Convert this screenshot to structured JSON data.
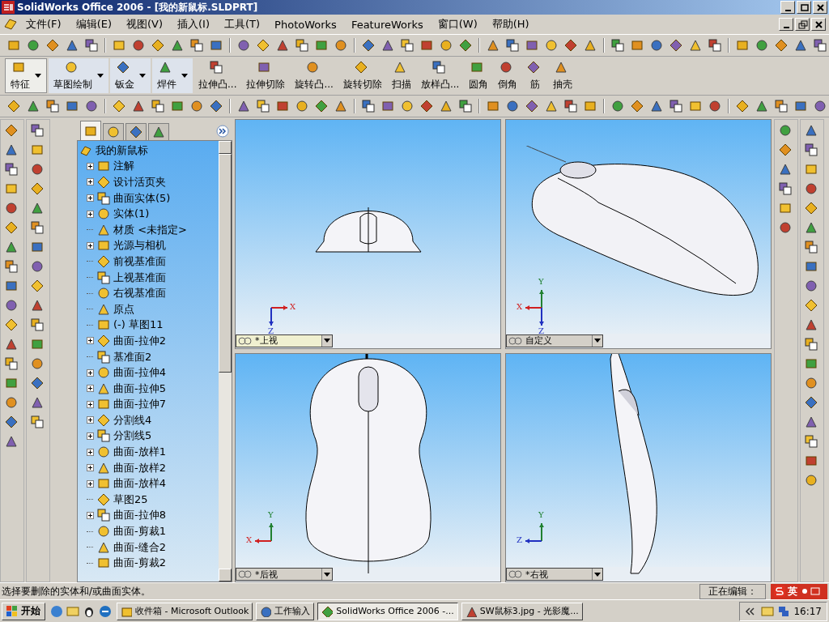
{
  "window": {
    "title": "SolidWorks Office 2006 - [我的新鼠标.SLDPRT]"
  },
  "menu": [
    "文件(F)",
    "编辑(E)",
    "视图(V)",
    "插入(I)",
    "工具(T)",
    "PhotoWorks",
    "FeatureWorks",
    "窗口(W)",
    "帮助(H)"
  ],
  "command_manager": [
    {
      "label": "特征",
      "kind": "group",
      "selected": true
    },
    {
      "label": "草图绘制",
      "kind": "group",
      "selected": false
    },
    {
      "label": "钣金",
      "kind": "group",
      "selected": false
    },
    {
      "label": "焊件",
      "kind": "group",
      "selected": false
    },
    {
      "label": "拉伸凸...",
      "kind": "tool"
    },
    {
      "label": "拉伸切除",
      "kind": "tool"
    },
    {
      "label": "旋转凸...",
      "kind": "tool"
    },
    {
      "label": "旋转切除",
      "kind": "tool"
    },
    {
      "label": "扫描",
      "kind": "tool"
    },
    {
      "label": "放样凸...",
      "kind": "tool"
    },
    {
      "label": "圆角",
      "kind": "tool"
    },
    {
      "label": "倒角",
      "kind": "tool"
    },
    {
      "label": "筋",
      "kind": "tool"
    },
    {
      "label": "抽壳",
      "kind": "tool"
    }
  ],
  "tree_tabs": [
    {
      "selected": true
    },
    {
      "selected": false
    },
    {
      "selected": false
    },
    {
      "selected": false
    }
  ],
  "tree": {
    "label": "我的新鼠标",
    "children": [
      {
        "label": "注解",
        "expandable": true
      },
      {
        "label": "设计活页夹",
        "expandable": true
      },
      {
        "label": "曲面实体(5)",
        "expandable": true
      },
      {
        "label": "实体(1)",
        "expandable": true
      },
      {
        "label": "材质 <未指定>",
        "expandable": false
      },
      {
        "label": "光源与相机",
        "expandable": true
      },
      {
        "label": "前视基准面",
        "expandable": false
      },
      {
        "label": "上视基准面",
        "expandable": false
      },
      {
        "label": "右视基准面",
        "expandable": false
      },
      {
        "label": "原点",
        "expandable": false
      },
      {
        "label": "(-) 草图11",
        "expandable": false
      },
      {
        "label": "曲面-拉伸2",
        "expandable": true
      },
      {
        "label": "基准面2",
        "expandable": false
      },
      {
        "label": "曲面-拉伸4",
        "expandable": true
      },
      {
        "label": "曲面-拉伸5",
        "expandable": true
      },
      {
        "label": "曲面-拉伸7",
        "expandable": true
      },
      {
        "label": "分割线4",
        "expandable": true
      },
      {
        "label": "分割线5",
        "expandable": true
      },
      {
        "label": "曲面-放样1",
        "expandable": true
      },
      {
        "label": "曲面-放样2",
        "expandable": true
      },
      {
        "label": "曲面-放样4",
        "expandable": true
      },
      {
        "label": "草图25",
        "expandable": false
      },
      {
        "label": "曲面-拉伸8",
        "expandable": true
      },
      {
        "label": "曲面-剪裁1",
        "expandable": false
      },
      {
        "label": "曲面-缝合2",
        "expandable": false
      },
      {
        "label": "曲面-剪裁2",
        "expandable": false
      }
    ]
  },
  "viewports": [
    {
      "kind": "top",
      "label": "*上视",
      "selected": true,
      "axes": [
        {
          "label": "X",
          "kind": "right",
          "color": "#d02020"
        },
        {
          "label": "Z",
          "kind": "down",
          "color": "#2030c0"
        }
      ]
    },
    {
      "kind": "iso",
      "label": "自定义",
      "selected": false,
      "axes": [
        {
          "label": "Y",
          "kind": "up",
          "color": "#208030"
        },
        {
          "label": "X",
          "kind": "left",
          "color": "#d02020"
        },
        {
          "label": "Z",
          "kind": "down",
          "color": "#2030c0"
        }
      ]
    },
    {
      "kind": "back",
      "label": "*后视",
      "selected": false,
      "axes": [
        {
          "label": "Y",
          "kind": "up",
          "color": "#208030"
        },
        {
          "label": "X",
          "kind": "left",
          "color": "#d02020"
        }
      ]
    },
    {
      "kind": "right",
      "label": "*右视",
      "selected": false,
      "axes": [
        {
          "label": "Y",
          "kind": "up",
          "color": "#208030"
        },
        {
          "label": "Z",
          "kind": "left",
          "color": "#2030c0"
        }
      ]
    }
  ],
  "status_bar": {
    "message": "选择要删除的实体和/或曲面实体。",
    "editing": "正在编辑：",
    "ime": "英"
  },
  "taskbar": {
    "start": "开始",
    "tasks": [
      {
        "label": "收件箱 - Microsoft Outlook",
        "selected": false
      },
      {
        "label": "工作输入",
        "selected": false
      },
      {
        "label": "SolidWorks Office 2006 -...",
        "selected": true
      },
      {
        "label": "SW鼠标3.jpg - 光影魔...",
        "selected": false
      }
    ],
    "clock": "16:17"
  }
}
